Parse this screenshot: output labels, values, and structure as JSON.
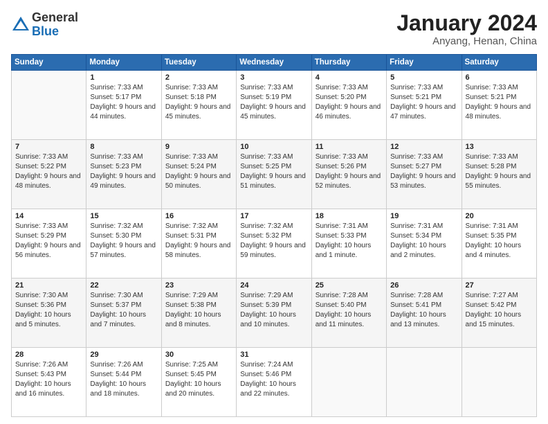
{
  "logo": {
    "general": "General",
    "blue": "Blue"
  },
  "title": "January 2024",
  "subtitle": "Anyang, Henan, China",
  "days_header": [
    "Sunday",
    "Monday",
    "Tuesday",
    "Wednesday",
    "Thursday",
    "Friday",
    "Saturday"
  ],
  "weeks": [
    [
      {
        "day": "",
        "sunrise": "",
        "sunset": "",
        "daylight": ""
      },
      {
        "day": "1",
        "sunrise": "Sunrise: 7:33 AM",
        "sunset": "Sunset: 5:17 PM",
        "daylight": "Daylight: 9 hours and 44 minutes."
      },
      {
        "day": "2",
        "sunrise": "Sunrise: 7:33 AM",
        "sunset": "Sunset: 5:18 PM",
        "daylight": "Daylight: 9 hours and 45 minutes."
      },
      {
        "day": "3",
        "sunrise": "Sunrise: 7:33 AM",
        "sunset": "Sunset: 5:19 PM",
        "daylight": "Daylight: 9 hours and 45 minutes."
      },
      {
        "day": "4",
        "sunrise": "Sunrise: 7:33 AM",
        "sunset": "Sunset: 5:20 PM",
        "daylight": "Daylight: 9 hours and 46 minutes."
      },
      {
        "day": "5",
        "sunrise": "Sunrise: 7:33 AM",
        "sunset": "Sunset: 5:21 PM",
        "daylight": "Daylight: 9 hours and 47 minutes."
      },
      {
        "day": "6",
        "sunrise": "Sunrise: 7:33 AM",
        "sunset": "Sunset: 5:21 PM",
        "daylight": "Daylight: 9 hours and 48 minutes."
      }
    ],
    [
      {
        "day": "7",
        "sunrise": "Sunrise: 7:33 AM",
        "sunset": "Sunset: 5:22 PM",
        "daylight": "Daylight: 9 hours and 48 minutes."
      },
      {
        "day": "8",
        "sunrise": "Sunrise: 7:33 AM",
        "sunset": "Sunset: 5:23 PM",
        "daylight": "Daylight: 9 hours and 49 minutes."
      },
      {
        "day": "9",
        "sunrise": "Sunrise: 7:33 AM",
        "sunset": "Sunset: 5:24 PM",
        "daylight": "Daylight: 9 hours and 50 minutes."
      },
      {
        "day": "10",
        "sunrise": "Sunrise: 7:33 AM",
        "sunset": "Sunset: 5:25 PM",
        "daylight": "Daylight: 9 hours and 51 minutes."
      },
      {
        "day": "11",
        "sunrise": "Sunrise: 7:33 AM",
        "sunset": "Sunset: 5:26 PM",
        "daylight": "Daylight: 9 hours and 52 minutes."
      },
      {
        "day": "12",
        "sunrise": "Sunrise: 7:33 AM",
        "sunset": "Sunset: 5:27 PM",
        "daylight": "Daylight: 9 hours and 53 minutes."
      },
      {
        "day": "13",
        "sunrise": "Sunrise: 7:33 AM",
        "sunset": "Sunset: 5:28 PM",
        "daylight": "Daylight: 9 hours and 55 minutes."
      }
    ],
    [
      {
        "day": "14",
        "sunrise": "Sunrise: 7:33 AM",
        "sunset": "Sunset: 5:29 PM",
        "daylight": "Daylight: 9 hours and 56 minutes."
      },
      {
        "day": "15",
        "sunrise": "Sunrise: 7:32 AM",
        "sunset": "Sunset: 5:30 PM",
        "daylight": "Daylight: 9 hours and 57 minutes."
      },
      {
        "day": "16",
        "sunrise": "Sunrise: 7:32 AM",
        "sunset": "Sunset: 5:31 PM",
        "daylight": "Daylight: 9 hours and 58 minutes."
      },
      {
        "day": "17",
        "sunrise": "Sunrise: 7:32 AM",
        "sunset": "Sunset: 5:32 PM",
        "daylight": "Daylight: 9 hours and 59 minutes."
      },
      {
        "day": "18",
        "sunrise": "Sunrise: 7:31 AM",
        "sunset": "Sunset: 5:33 PM",
        "daylight": "Daylight: 10 hours and 1 minute."
      },
      {
        "day": "19",
        "sunrise": "Sunrise: 7:31 AM",
        "sunset": "Sunset: 5:34 PM",
        "daylight": "Daylight: 10 hours and 2 minutes."
      },
      {
        "day": "20",
        "sunrise": "Sunrise: 7:31 AM",
        "sunset": "Sunset: 5:35 PM",
        "daylight": "Daylight: 10 hours and 4 minutes."
      }
    ],
    [
      {
        "day": "21",
        "sunrise": "Sunrise: 7:30 AM",
        "sunset": "Sunset: 5:36 PM",
        "daylight": "Daylight: 10 hours and 5 minutes."
      },
      {
        "day": "22",
        "sunrise": "Sunrise: 7:30 AM",
        "sunset": "Sunset: 5:37 PM",
        "daylight": "Daylight: 10 hours and 7 minutes."
      },
      {
        "day": "23",
        "sunrise": "Sunrise: 7:29 AM",
        "sunset": "Sunset: 5:38 PM",
        "daylight": "Daylight: 10 hours and 8 minutes."
      },
      {
        "day": "24",
        "sunrise": "Sunrise: 7:29 AM",
        "sunset": "Sunset: 5:39 PM",
        "daylight": "Daylight: 10 hours and 10 minutes."
      },
      {
        "day": "25",
        "sunrise": "Sunrise: 7:28 AM",
        "sunset": "Sunset: 5:40 PM",
        "daylight": "Daylight: 10 hours and 11 minutes."
      },
      {
        "day": "26",
        "sunrise": "Sunrise: 7:28 AM",
        "sunset": "Sunset: 5:41 PM",
        "daylight": "Daylight: 10 hours and 13 minutes."
      },
      {
        "day": "27",
        "sunrise": "Sunrise: 7:27 AM",
        "sunset": "Sunset: 5:42 PM",
        "daylight": "Daylight: 10 hours and 15 minutes."
      }
    ],
    [
      {
        "day": "28",
        "sunrise": "Sunrise: 7:26 AM",
        "sunset": "Sunset: 5:43 PM",
        "daylight": "Daylight: 10 hours and 16 minutes."
      },
      {
        "day": "29",
        "sunrise": "Sunrise: 7:26 AM",
        "sunset": "Sunset: 5:44 PM",
        "daylight": "Daylight: 10 hours and 18 minutes."
      },
      {
        "day": "30",
        "sunrise": "Sunrise: 7:25 AM",
        "sunset": "Sunset: 5:45 PM",
        "daylight": "Daylight: 10 hours and 20 minutes."
      },
      {
        "day": "31",
        "sunrise": "Sunrise: 7:24 AM",
        "sunset": "Sunset: 5:46 PM",
        "daylight": "Daylight: 10 hours and 22 minutes."
      },
      {
        "day": "",
        "sunrise": "",
        "sunset": "",
        "daylight": ""
      },
      {
        "day": "",
        "sunrise": "",
        "sunset": "",
        "daylight": ""
      },
      {
        "day": "",
        "sunrise": "",
        "sunset": "",
        "daylight": ""
      }
    ]
  ]
}
